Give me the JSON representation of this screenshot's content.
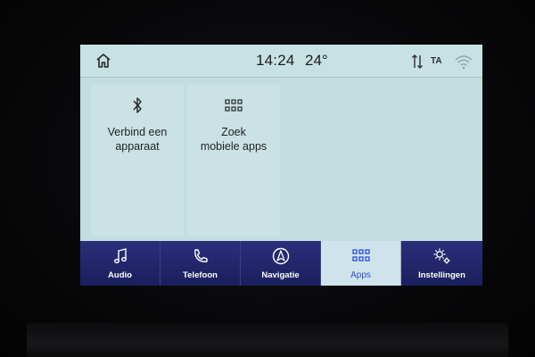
{
  "status": {
    "time": "14:24",
    "temperature": "24°",
    "ta": "TA"
  },
  "tiles": [
    {
      "label_line1": "Verbind een",
      "label_line2": "apparaat",
      "icon": "bluetooth-icon"
    },
    {
      "label_line1": "Zoek",
      "label_line2": "mobiele apps",
      "icon": "apps-grid-icon"
    }
  ],
  "nav": {
    "items": [
      {
        "label": "Audio",
        "icon": "music-note-icon",
        "active": false
      },
      {
        "label": "Telefoon",
        "icon": "phone-icon",
        "active": false
      },
      {
        "label": "Navigatie",
        "icon": "navigation-icon",
        "active": false
      },
      {
        "label": "Apps",
        "icon": "apps-grid-icon",
        "active": true
      },
      {
        "label": "Instellingen",
        "icon": "gear-icon",
        "active": false
      }
    ]
  },
  "colors": {
    "screen_bg": "#c3dde1",
    "nav_bg": "#22276b",
    "active_label": "#2b4dd6"
  }
}
